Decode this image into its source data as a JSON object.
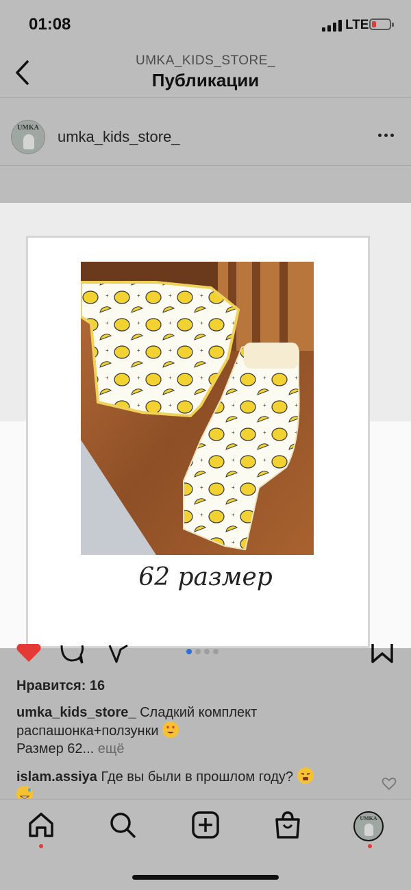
{
  "status_bar": {
    "time": "01:08",
    "network": "LTE",
    "battery_color": "#e53935"
  },
  "header": {
    "username": "UMKA_KIDS_STORE_",
    "title": "Публикации"
  },
  "post": {
    "avatar_text": "UMKA",
    "username": "umka_kids_store_",
    "image_caption": "62 размер",
    "carousel": {
      "count": 4,
      "active": 1,
      "active_color": "#2b6fd6"
    },
    "likes": "Нравится: 16",
    "caption": {
      "author": "umka_kids_store_",
      "line1": "Сладкий комплект",
      "line2": "распашонка+ползунки",
      "line3": "Размер 62...",
      "more": "ещё"
    },
    "comment": {
      "author": "islam.assiya",
      "text": "Где вы были в прошлом году?"
    }
  },
  "tabbar": {
    "avatar_text": "UMKA",
    "icons": [
      "home-icon",
      "search-icon",
      "new-post-icon",
      "shop-icon",
      "profile-icon"
    ]
  }
}
